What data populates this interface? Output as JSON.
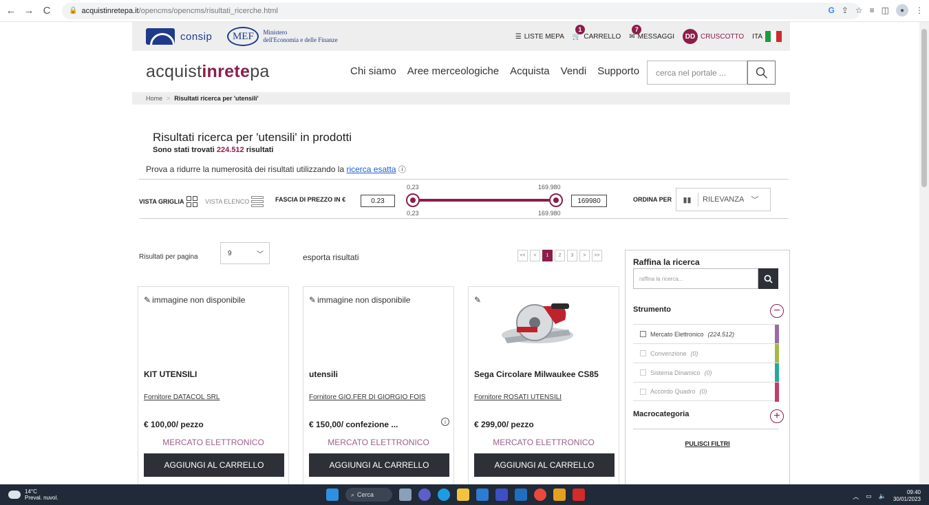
{
  "browser": {
    "url_host": "acquistinretepa.it",
    "url_path": "/opencms/opencms/risultati_ricerche.html"
  },
  "gov_header": {
    "consip": "consip",
    "mef": "MEF",
    "mef_line1": "Ministero",
    "mef_line2": "dell'Economia e delle Finanze",
    "liste_mepa": "LISTE MEPA",
    "carrello": "CARRELLO",
    "carrello_count": "1",
    "messaggi": "MESSAGGI",
    "messaggi_count": "7",
    "user_initials": "DD",
    "cruscotto": "CRUSCOTTO",
    "language": "ITA"
  },
  "brand": {
    "prefix": "acquist",
    "middle": "inrete",
    "suffix": "pa"
  },
  "nav": {
    "items": [
      "Chi siamo",
      "Aree merceologiche",
      "Acquista",
      "Vendi",
      "Supporto"
    ],
    "search_placeholder": "cerca nel portale ..."
  },
  "breadcrumb": {
    "home": "Home",
    "sep": ">",
    "current": "Risultati ricerca per 'utensili'"
  },
  "results": {
    "title": "Risultati ricerca per 'utensili' in prodotti",
    "count_prefix": "Sono stati trovati ",
    "count": "224.512",
    "count_suffix": " risultati",
    "hint_prefix": "Prova a ridurre la numerosità dei risultati utilizzando la ",
    "hint_link": "ricerca esatta"
  },
  "filter_bar": {
    "view_grid": "VISTA GRIGLIA",
    "view_list": "VISTA ELENCO",
    "price_label": "FASCIA DI PREZZO IN €",
    "price_min": "0.23",
    "price_max": "169980",
    "slider_min_label": "0,23",
    "slider_max_label": "169.980",
    "sort_label": "ORDINA PER",
    "sort_value": "RILEVANZA"
  },
  "listing": {
    "per_page_label": "Risultati per pagina",
    "per_page_value": "9",
    "export": "esporta risultati",
    "pages": [
      "<<",
      "<",
      "1",
      "2",
      "3",
      ">",
      ">>"
    ]
  },
  "products": [
    {
      "img_alt": "immagine non disponibile",
      "title": "KIT UTENSILI",
      "supplier": "Fornitore DATACOL SRL",
      "price": "€ 100,00/ pezzo",
      "channel": "MERCATO ELETTRONICO",
      "button": "AGGIUNGI AL CARRELLO"
    },
    {
      "img_alt": "immagine non disponibile",
      "title": "utensili",
      "supplier": "Fornitore GIO.FER DI GIORGIO FOIS",
      "price": "€ 150,00/ confezione ...",
      "channel": "MERCATO ELETTRONICO",
      "button": "AGGIUNGI AL CARRELLO"
    },
    {
      "img_alt": "",
      "title": "Sega Circolare Milwaukee CS85",
      "supplier": "Fornitore ROSATI UTENSILI",
      "price": "€ 299,00/ pezzo",
      "channel": "MERCATO ELETTRONICO",
      "button": "AGGIUNGI AL CARRELLO"
    }
  ],
  "refine": {
    "title": "Raffina la ricerca",
    "placeholder": "raffina la ricerca...",
    "strumento": "Strumento",
    "filters": [
      {
        "label": "Mercato Elettronico",
        "count": "(224.512)",
        "color": "#9b6aa6"
      },
      {
        "label": "Convenzione",
        "count": "(0)",
        "color": "#a3b84a"
      },
      {
        "label": "Sistema Dinamico",
        "count": "(0)",
        "color": "#2aa79b"
      },
      {
        "label": "Accordo Quadro",
        "count": "(0)",
        "color": "#c23d6a"
      }
    ],
    "macrocategoria": "Macrocategoria",
    "reset": "PULISCI FILTRI"
  },
  "taskbar": {
    "temp": "14°C",
    "weather": "Preval. nuvol.",
    "search": "Cerca",
    "time": "09:40",
    "date": "30/01/2023"
  },
  "colors": {
    "accent": "#8b1e4b",
    "button_dark": "#2d3036"
  }
}
